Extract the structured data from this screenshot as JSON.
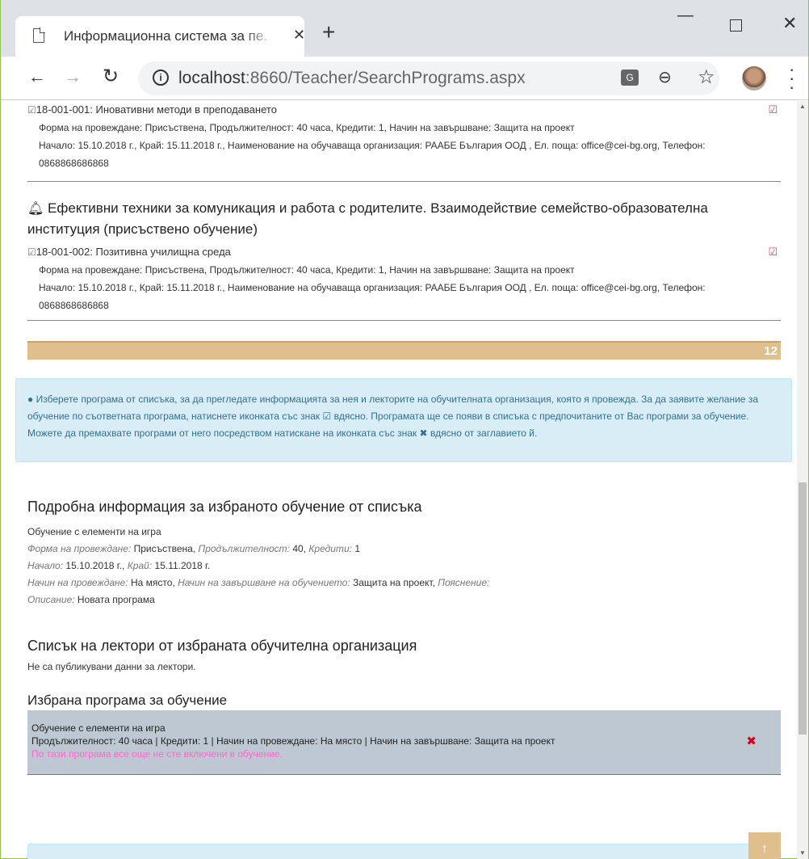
{
  "browser": {
    "tab_title": "Информационна система за пе.",
    "tab_close": "✕",
    "new_tab": "+",
    "url_host": "localhost",
    "url_rest": ":8660/Teacher/SearchPrograms.aspx",
    "info_glyph": "i",
    "translate_glyph": "G",
    "minimize": "—",
    "close": "✕"
  },
  "programs": [
    {
      "code": "18-001-001:",
      "name": "Иновативни методи в преподаването",
      "line1": "Форма на провеждане: Присъствена, Продължителност: 40 часа, Кредити: 1, Начин на завършване: Защита на проект",
      "line2": "Начало: 15.10.2018 г., Край: 15.11.2018 г., Наименование на обучаваща организация: РААБЕ България ООД , Ел. поща: office@cei-bg.org, Телефон:",
      "line3": "0868868686868"
    },
    {
      "code": "18-001-002:",
      "name": "Позитивна училищна среда",
      "line1": "Форма на провеждане: Присъствена, Продължителност: 40 часа, Кредити: 1, Начин на завършване: Защита на проект",
      "line2": "Начало: 15.10.2018 г., Край: 15.11.2018 г., Наименование на обучаваща организация: РААБЕ България ООД , Ел. поща: office@cei-bg.org, Телефон:",
      "line3": "0868868686868"
    }
  ],
  "group_title": "Ефективни техники за комуникация и работа с родителите. Взаимодействие семейство-образователна институция (присъствено обучение)",
  "group_count": "12",
  "alert": {
    "part1": "Изберете програма от списъка, за да прегледате информацията за нея и лекторите на обучителната организация, която я провежда. За да заявите желание за обучение по съответната програма, натиснете иконката със знак",
    "part2": "вдясно. Програмата ще се появи в списъка с предпочитаните от Вас програми за обучение. Можете да премахвате програми от него посредством натискане на иконката със знак",
    "part3": "вдясно от заглавието й."
  },
  "details": {
    "heading": "Подробна информация за избраното обучение от списъка",
    "name": "Обучение с елементи на игра",
    "form_label": "Форма на провеждане:",
    "form_value": "Присъствена,",
    "duration_label": "Продължителност:",
    "duration_value": "40,",
    "credits_label": "Кредити:",
    "credits_value": "1",
    "start_label": "Начало:",
    "start_value": "15.10.2018 г.,",
    "end_label": "Край:",
    "end_value": "15.11.2018 г.",
    "conduct_label": "Начин на провеждане:",
    "conduct_value": "На място,",
    "completion_label": "Начин на завършване на обучението:",
    "completion_value": "Защита на проект,",
    "note_label": "Пояснение:",
    "desc_label": "Описание:",
    "desc_value": "Новата програма"
  },
  "lecturers": {
    "heading": "Списък на лектори от избраната обучителна организация",
    "text": "Не са публикувани данни за лектори."
  },
  "selected": {
    "heading": "Избрана програма за обучение",
    "name": "Обучение с елементи на игра",
    "info": "Продължителност: 40 часа | Кредити: 1 | Начин на провеждане: На място | Начин на завършване: Защита на проект",
    "status": "По тази програма все още не сте включени в обучение."
  },
  "colors": {
    "accent_tan": "#dfc08c",
    "check_red": "#d9534f",
    "alert_bg": "#d9edf7",
    "status_pink": "#ff66cc"
  }
}
